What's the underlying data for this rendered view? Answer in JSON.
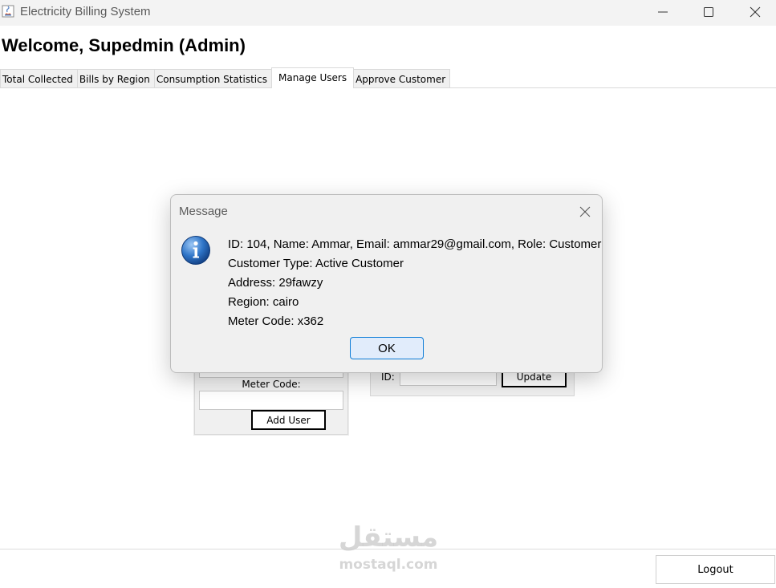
{
  "window": {
    "title": "Electricity Billing System"
  },
  "main": {
    "welcome": "Welcome, Supedmin (Admin)",
    "tabs": [
      {
        "label": "Total Collected"
      },
      {
        "label": "Bills by Region"
      },
      {
        "label": "Consumption Statistics"
      },
      {
        "label": "Manage Users",
        "selected": true
      },
      {
        "label": "Approve Customer"
      }
    ],
    "add_panel": {
      "meter_label": "Meter Code:",
      "add_button": "Add User"
    },
    "update_panel": {
      "id_label": "ID:",
      "update_button": "Update"
    },
    "logout_button": "Logout"
  },
  "dialog": {
    "title": "Message",
    "lines": [
      "ID: 104, Name: Ammar, Email: ammar29@gmail.com, Role: Customer",
      "Customer Type: Active Customer",
      "Address: 29fawzy",
      "Region: cairo",
      "Meter Code: x362"
    ],
    "ok_button": "OK"
  },
  "watermark": {
    "arabic": "مستقل",
    "latin": "mostaql.com"
  },
  "colors": {
    "ok_border": "#0b7bd7",
    "ok_fill": "#e1ecfb",
    "info_icon": "#1f63b6"
  }
}
